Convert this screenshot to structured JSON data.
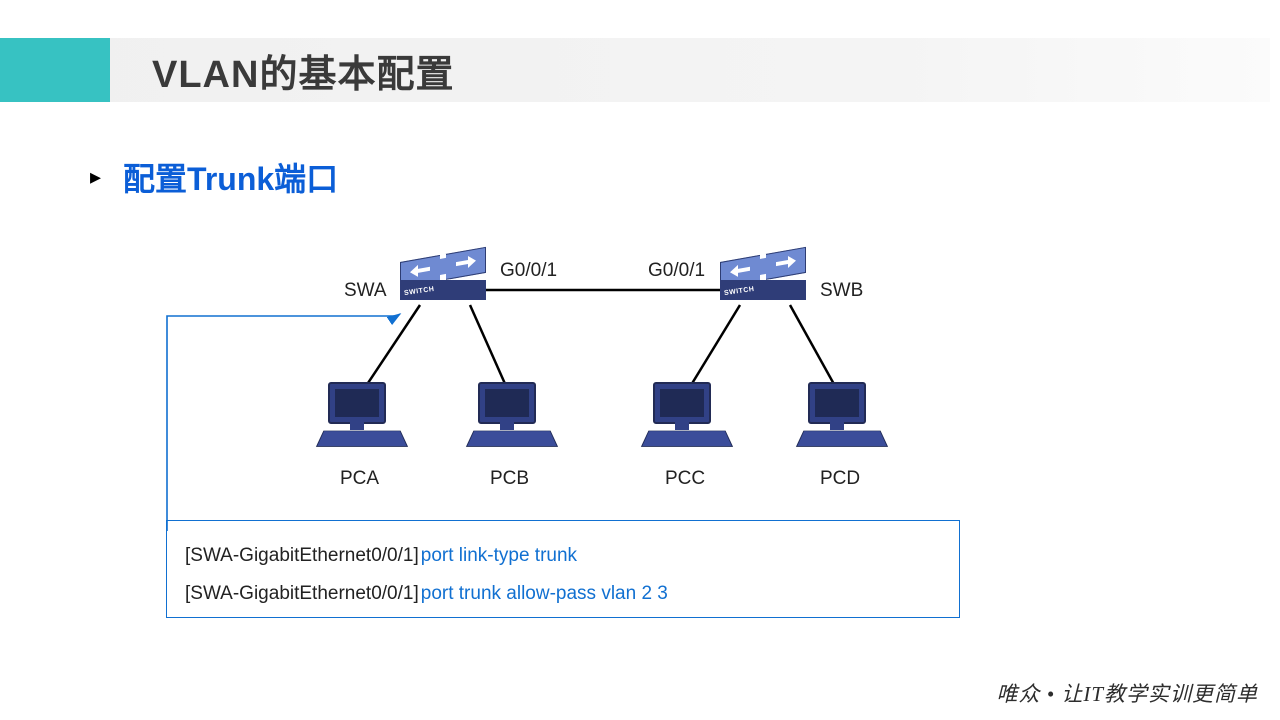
{
  "header": {
    "title": "VLAN的基本配置"
  },
  "subtitle": {
    "bullet": "▸",
    "text": "配置Trunk端口"
  },
  "diagram": {
    "switches": [
      {
        "name": "SWA",
        "port": "G0/0/1"
      },
      {
        "name": "SWB",
        "port": "G0/0/1"
      }
    ],
    "pcs": [
      "PCA",
      "PCB",
      "PCC",
      "PCD"
    ],
    "switch_glyph": "✦"
  },
  "config": {
    "lines": [
      {
        "prompt": "[SWA-GigabitEthernet0/0/1]",
        "cmd": "port  link-type  trunk"
      },
      {
        "prompt": "[SWA-GigabitEthernet0/0/1]",
        "cmd": "port  trunk  allow-pass  vlan 2 3"
      }
    ]
  },
  "footer": {
    "text": "唯众 • 让IT教学实训更简单"
  }
}
